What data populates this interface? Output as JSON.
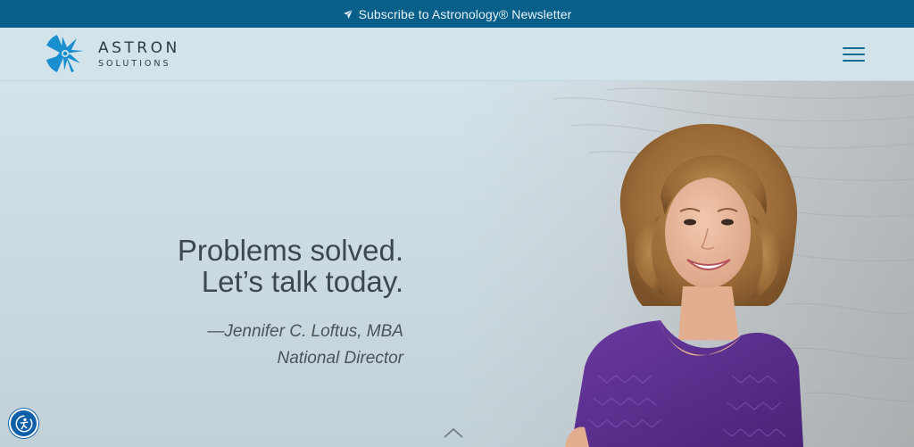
{
  "topbar": {
    "icon": "paper-plane-icon",
    "text": "Subscribe to Astronology® Newsletter"
  },
  "header": {
    "logo": {
      "icon": "astron-star-logo-icon",
      "title": "ASTRON",
      "subtitle": "SOLUTIONS"
    },
    "menu_icon": "hamburger-menu-icon"
  },
  "hero": {
    "headline": [
      "Problems solved.",
      "Let’s talk today."
    ],
    "attribution": [
      "—Jennifer C. Loftus, MBA",
      "National Director"
    ],
    "scroll_icon": "chevron-up-icon"
  },
  "accessibility": {
    "icon": "accessibility-icon"
  },
  "colors": {
    "topbar_bg": "#08608a",
    "header_bg": "#d3e3ea",
    "accent": "#0b6a98",
    "logo_blue": "#1a8fd0",
    "text_dark": "#3d474f",
    "sweater_purple": "#5b2d8c"
  }
}
